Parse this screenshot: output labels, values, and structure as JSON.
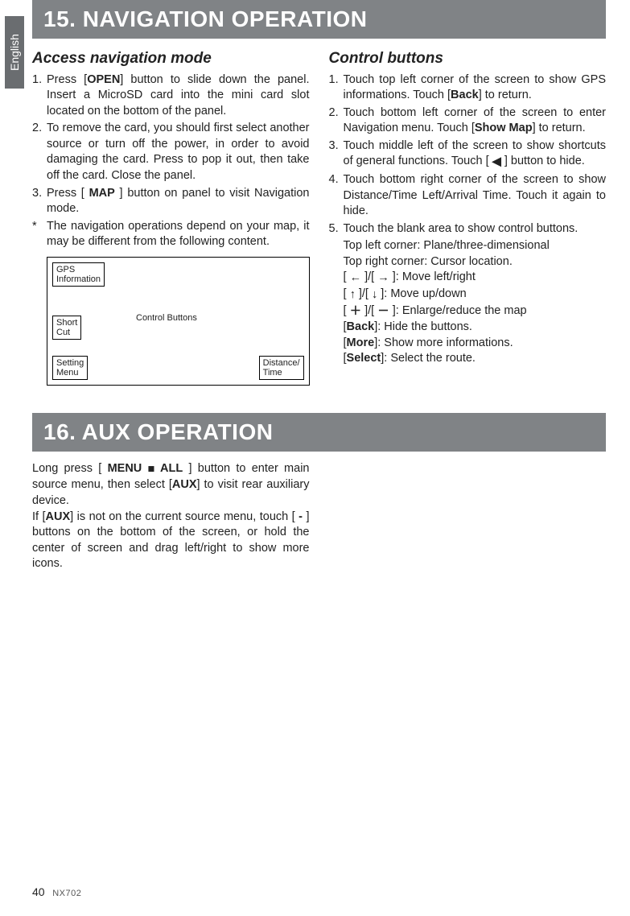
{
  "sideTab": "English",
  "section15": {
    "title": "15. NAVIGATION OPERATION",
    "left": {
      "heading": "Access navigation mode",
      "item1": {
        "num": "1.",
        "pre": "Press [",
        "bold": "OPEN",
        "post": "] button to slide down the panel. Insert a MicroSD card into the mini card slot located on the bottom of the panel."
      },
      "item2": {
        "num": "2.",
        "text": "To remove the card, you should first select another source or turn off the power, in order to avoid damaging the card. Press to pop it out, then take off the card. Close the panel."
      },
      "item3": {
        "num": "3.",
        "pre": "Press [ ",
        "bold": "MAP",
        "post": " ] button on panel to visit Navigation mode."
      },
      "note": {
        "star": "*",
        "text": "The navigation operations depend on your map, it may be different from the following content."
      },
      "diagram": {
        "gps": "GPS\nInformation",
        "short": "Short\nCut",
        "setting": "Setting\nMenu",
        "control": "Control Buttons",
        "dist": "Distance/\nTime"
      }
    },
    "right": {
      "heading": "Control buttons",
      "i1": {
        "num": "1.",
        "pre": "Touch top left corner of the screen to show GPS informations. Touch [",
        "b1": "Back",
        "post": "] to return."
      },
      "i2": {
        "num": "2.",
        "pre": "Touch bottom left corner of the screen to enter Navigation menu. Touch [",
        "b1": "Show Map",
        "post": "] to return."
      },
      "i3": {
        "num": "3.",
        "text": "Touch middle left of the screen to show shortcuts of general functions. Touch [ ",
        "icon": "◀",
        "post": " ] button to hide."
      },
      "i4": {
        "num": "4.",
        "text": "Touch bottom right corner of the screen to show Distance/Time Left/Arrival Time. Touch it again to hide."
      },
      "i5": {
        "num": "5.",
        "text": "Touch the blank area to show control buttons."
      },
      "line_tl": "Top left corner:  Plane/three-dimensional",
      "line_tr": "Top right corner: Cursor location.",
      "line_lr": {
        "pre": "[ ",
        "i1": "←",
        "mid": " ]/[ ",
        "i2": "→",
        "post": " ]: Move left/right"
      },
      "line_ud": {
        "pre": "[ ",
        "i1": "↑",
        "mid": " ]/[ ",
        "i2": "↓",
        "post": " ]: Move up/down"
      },
      "line_pm": {
        "pre": "[ ",
        "i1": "＋",
        "mid": " ]/[ ",
        "i2": "－",
        "post": " ]: Enlarge/reduce the map"
      },
      "line_back": {
        "open": "[",
        "b": "Back",
        "close": "]: Hide the buttons."
      },
      "line_more": {
        "open": "[",
        "b": "More",
        "close": "]: Show more informations."
      },
      "line_select": {
        "open": "[",
        "b": "Select",
        "close": "]: Select the route."
      }
    }
  },
  "section16": {
    "title": "16. AUX OPERATION",
    "p1": {
      "pre": "Long press [ ",
      "b1": "MENU ",
      "sq": "■",
      "b2": " ALL",
      "mid": " ] button to enter main source menu, then select [",
      "b3": "AUX",
      "post": "] to visit rear auxiliary device."
    },
    "p2": {
      "pre": "If [",
      "b1": "AUX",
      "mid": "] is not on the current source menu, touch [ ",
      "b2": "-",
      "post": " ] buttons on the bottom of the screen, or hold the center of screen and drag left/right to show more icons."
    }
  },
  "footer": {
    "page": "40",
    "model": "NX702"
  }
}
